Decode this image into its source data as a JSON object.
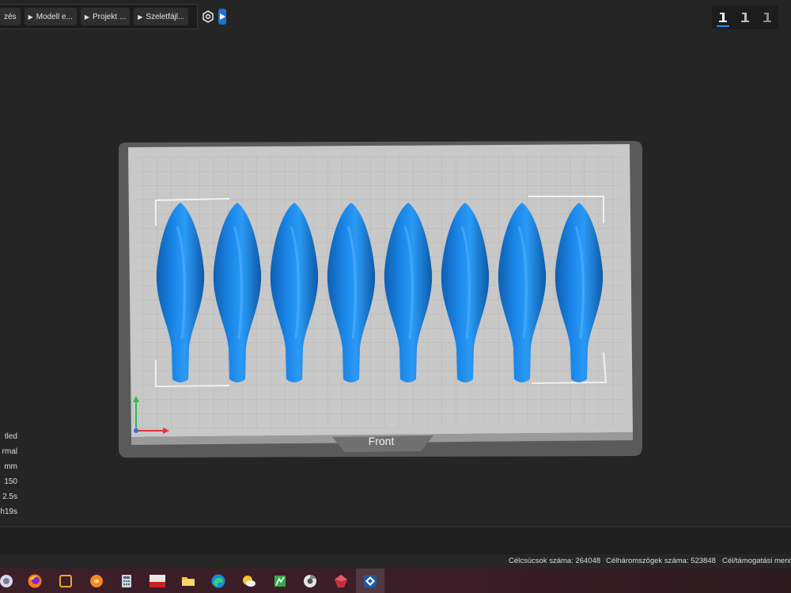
{
  "toolbar": {
    "breadcrumbs": [
      {
        "label": "zés"
      },
      {
        "label": "Modell e..."
      },
      {
        "label": "Projekt ..."
      },
      {
        "label": "Szeletfájl..."
      }
    ]
  },
  "viewport": {
    "front_label": "Front",
    "model_count": 8,
    "accent": "#1a86e8",
    "plate_color": "#c8c8c8"
  },
  "left_info": [
    "tled",
    "rmal",
    "mm",
    "150",
    "2.5s",
    "h19s"
  ],
  "status": {
    "vertices_label": "Célcsúcsok száma:",
    "vertices_value": "264048",
    "triangles_label": "Célháromszögek száma:",
    "triangles_value": "523848",
    "support_label": "Cél/támogatási menn"
  },
  "taskbar": {
    "icons": [
      "app-icon",
      "firefox-icon",
      "square-app-icon",
      "orange-app-icon",
      "calculator-icon",
      "unix-app-icon",
      "folder-icon",
      "edge-icon",
      "weather-icon",
      "green-app-icon",
      "chrome-like-icon",
      "red-gem-icon",
      "slicer-app-icon"
    ]
  }
}
